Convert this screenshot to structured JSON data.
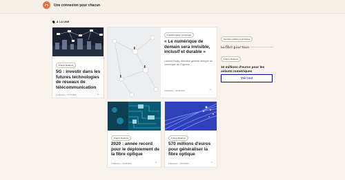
{
  "header": {
    "brand_name": "Une connexion pour chacun",
    "logo_icon": "orange-globe-logo",
    "accent_color": "#e8714a"
  },
  "section": {
    "label": "À LA UNE",
    "icon": "pin-icon"
  },
  "cards": [
    {
      "tag": "France Relance",
      "title": "5G : investir dans les futures technologies de réseaux de télécommunication",
      "date": "Publication - 07/07/2021",
      "image": "network-city-night"
    },
    {
      "tag": "Transformation numérique",
      "title": "« Le numérique de demain sera invisible, inclusif et durable »",
      "description": "Laurent Rojey, directeur général délégué au numérique de l'Agence...",
      "date": "Publication - 06/09/2021",
      "image": "network-nodes-people"
    },
    {
      "tag": "France Relance",
      "title": "2020 : année record pour le déploiement de la fibre optique",
      "date": "Publication - 20/05/2021",
      "image": "circuit-board"
    },
    {
      "tag": "France Relance",
      "title": "570 millions d'euros pour généraliser la fibre optique",
      "date": "Publication - 18/01/2021",
      "image": "fiber-optic-cables"
    }
  ],
  "side": {
    "items": [
      {
        "tag": "Services publics et territoires",
        "title": "La fibre pour tous"
      },
      {
        "tag": "France Relance",
        "title": "10 millions d'euros pour les aidants numériques"
      }
    ],
    "see_all_label": "Voir tout"
  },
  "colors": {
    "page_background": "#f7f3ec",
    "link_blue": "#000091"
  }
}
